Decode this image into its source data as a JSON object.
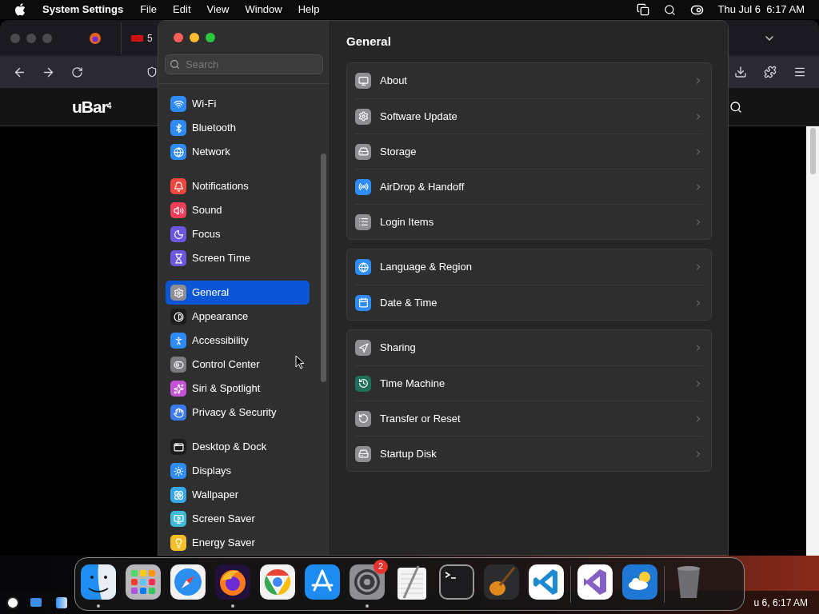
{
  "menu_bar": {
    "app": "System Settings",
    "menus": [
      "File",
      "Edit",
      "View",
      "Window",
      "Help"
    ],
    "clock": "Thu Jul 6  6:17 AM"
  },
  "browser": {
    "tab_label": "5",
    "site_logo": "uBar$^{4}$"
  },
  "settings": {
    "search": {
      "placeholder": "Search"
    },
    "sidebar_groups": [
      {
        "items": [
          {
            "label": "Wi-Fi",
            "kind": "wifi",
            "color": "#2f8cf6",
            "selected": false
          },
          {
            "label": "Bluetooth",
            "kind": "bluetooth",
            "color": "#2f8cf6",
            "selected": false
          },
          {
            "label": "Network",
            "kind": "network",
            "color": "#2f8cf6",
            "selected": false
          }
        ]
      },
      {
        "items": [
          {
            "label": "Notifications",
            "kind": "notifications",
            "color": "#f0473f",
            "selected": false
          },
          {
            "label": "Sound",
            "kind": "sound",
            "color": "#ee3e5b",
            "selected": false
          },
          {
            "label": "Focus",
            "kind": "focus",
            "color": "#6e57e0",
            "selected": false
          },
          {
            "label": "Screen Time",
            "kind": "screentime",
            "color": "#6e57e0",
            "selected": false
          }
        ]
      },
      {
        "items": [
          {
            "label": "General",
            "kind": "general",
            "color": "#8e8e93",
            "selected": true
          },
          {
            "label": "Appearance",
            "kind": "appearance",
            "color": "#1c1c1e",
            "selected": false
          },
          {
            "label": "Accessibility",
            "kind": "accessibility",
            "color": "#2f8cf6",
            "selected": false
          },
          {
            "label": "Control Center",
            "kind": "controlcenter",
            "color": "#7c7c80",
            "selected": false
          },
          {
            "label": "Siri & Spotlight",
            "kind": "siri",
            "color": "#c451d6",
            "selected": false
          },
          {
            "label": "Privacy & Security",
            "kind": "privacy",
            "color": "#3a7bf0",
            "selected": false
          }
        ]
      },
      {
        "items": [
          {
            "label": "Desktop & Dock",
            "kind": "desktop",
            "color": "#1c1c1e",
            "selected": false
          },
          {
            "label": "Displays",
            "kind": "displays",
            "color": "#2f8cf6",
            "selected": false
          },
          {
            "label": "Wallpaper",
            "kind": "wallpaper",
            "color": "#36a7e8",
            "selected": false
          },
          {
            "label": "Screen Saver",
            "kind": "screensaver",
            "color": "#40b8d8",
            "selected": false
          },
          {
            "label": "Energy Saver",
            "kind": "energy",
            "color": "#f5c027",
            "selected": false
          }
        ]
      }
    ],
    "title": "General",
    "groups": [
      {
        "rows": [
          {
            "label": "About",
            "kind": "about",
            "color": "#8e8e93"
          },
          {
            "label": "Software Update",
            "kind": "update",
            "color": "#8e8e93"
          },
          {
            "label": "Storage",
            "kind": "storage",
            "color": "#8e8e93"
          },
          {
            "label": "AirDrop & Handoff",
            "kind": "airdrop",
            "color": "#2f8cf6"
          },
          {
            "label": "Login Items",
            "kind": "login",
            "color": "#8e8e93"
          }
        ]
      },
      {
        "rows": [
          {
            "label": "Language & Region",
            "kind": "language",
            "color": "#2f8cf6"
          },
          {
            "label": "Date & Time",
            "kind": "date",
            "color": "#2f8cf6"
          }
        ]
      },
      {
        "rows": [
          {
            "label": "Sharing",
            "kind": "sharing",
            "color": "#8e8e93"
          },
          {
            "label": "Time Machine",
            "kind": "timemachine",
            "color": "#1f6f5a"
          },
          {
            "label": "Transfer or Reset",
            "kind": "transfer",
            "color": "#8e8e93"
          },
          {
            "label": "Startup Disk",
            "kind": "startup",
            "color": "#8e8e93"
          }
        ]
      }
    ]
  },
  "dock": {
    "sections": [
      {
        "items": [
          {
            "kind": "finder",
            "running": true
          },
          {
            "kind": "launchpad",
            "running": false
          },
          {
            "kind": "safari",
            "running": false
          },
          {
            "kind": "firefox",
            "running": true
          },
          {
            "kind": "chrome",
            "running": false
          },
          {
            "kind": "appstore",
            "running": false
          },
          {
            "kind": "settings",
            "running": true,
            "badge": "2"
          },
          {
            "kind": "textedit",
            "running": false
          },
          {
            "kind": "terminal",
            "running": false
          },
          {
            "kind": "garageband",
            "running": false
          },
          {
            "kind": "vscode",
            "running": false
          }
        ]
      },
      {
        "items": [
          {
            "kind": "visualstudio",
            "running": false
          },
          {
            "kind": "weather",
            "running": false
          }
        ]
      },
      {
        "items": [
          {
            "kind": "trash",
            "running": false
          }
        ]
      }
    ]
  },
  "taskbar": {
    "clock": "u 6, 6:17 AM"
  }
}
